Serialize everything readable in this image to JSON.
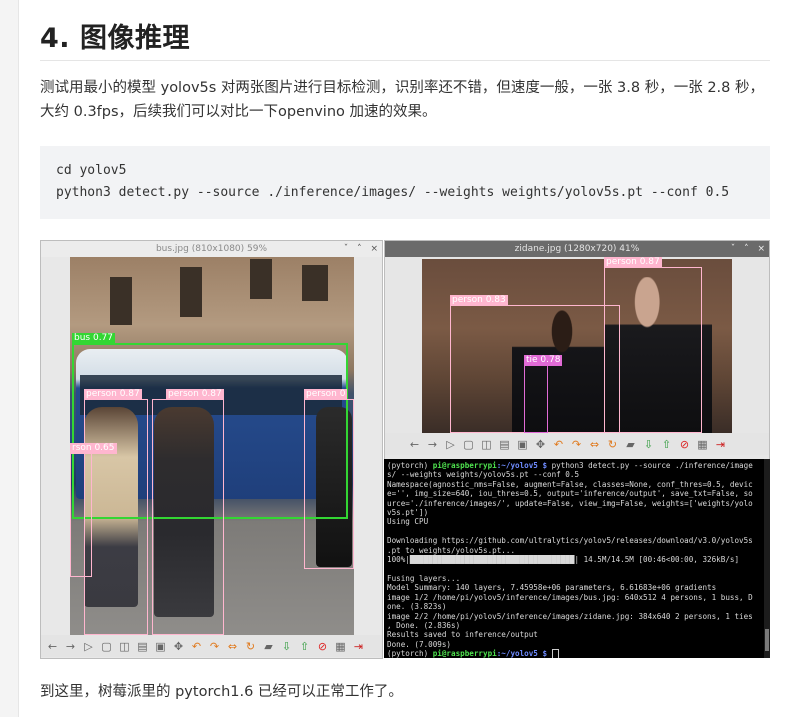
{
  "article": {
    "heading": "4. 图像推理",
    "paragraph": "测试用最小的模型 yolov5s 对两张图片进行目标检测，识别率还不错，但速度一般，一张 3.8 秒，一张 2.8 秒，大约 0.3fps，后续我们可以对比一下openvino 加速的效果。",
    "code_lines": [
      "cd yolov5",
      "python3 detect.py --source ./inference/images/ --weights weights/yolov5s.pt --conf 0.5"
    ],
    "closing": "到这里，树莓派里的 pytorch1.6 已经可以正常工作了。"
  },
  "bus_window": {
    "title": "bus.jpg (810x1080) 59%",
    "controls": [
      "ˇ",
      "˄",
      "×"
    ],
    "labels": {
      "bus": "bus 0.77",
      "person1": "person 0.87",
      "person2": "person 0.87",
      "person3": "person 0",
      "person4": "rson 0.65"
    }
  },
  "zidane_window": {
    "title": "zidane.jpg (1280x720) 41%",
    "controls": [
      "ˇ",
      "˄",
      "×"
    ],
    "labels": {
      "person1": "person 0.83",
      "person2": "person 0.87",
      "tie": "tie 0.78"
    }
  },
  "toolbar_icons": [
    "←",
    "→",
    "▷",
    "▢",
    "◫",
    "▤",
    "▣",
    "✥",
    "↶",
    "↷",
    "⇔",
    "↻",
    "▰",
    "⇩",
    "⇧",
    "⊘",
    "▦",
    "⇥"
  ],
  "terminal": {
    "prompt_env": "(pytorch) ",
    "prompt_user": "pi@raspberrypi",
    "prompt_path": ":~/yolov5 $ ",
    "command": "python3 detect.py --source ./inference/image",
    "lines": [
      "s/ --weights weights/yolov5s.pt --conf 0.5",
      "Namespace(agnostic_nms=False, augment=False, classes=None, conf_thres=0.5, devic",
      "e='', img_size=640, iou_thres=0.5, output='inference/output', save_txt=False, so",
      "urce='./inference/images/', update=False, view_img=False, weights=['weights/yolo",
      "v5s.pt'])",
      "Using CPU",
      "",
      "Downloading https://github.com/ultralytics/yolov5/releases/download/v3.0/yolov5s",
      ".pt to weights/yolov5s.pt...",
      "100%|████████████████████████████████████| 14.5M/14.5M [00:46<00:00, 326kB/s]",
      "",
      "Fusing layers...",
      "Model Summary: 140 layers, 7.45958e+06 parameters, 6.61683e+06 gradients",
      "image 1/2 /home/pi/yolov5/inference/images/bus.jpg: 640x512 4 persons, 1 buss, D",
      "one. (3.823s)",
      "image 2/2 /home/pi/yolov5/inference/images/zidane.jpg: 384x640 2 persons, 1 ties",
      ", Done. (2.836s)",
      "Results saved to inference/output",
      "Done. (7.009s)"
    ],
    "final_env": "(pytorch) ",
    "final_user": "pi@raspberrypi",
    "final_path": ":~/yolov5 $ "
  }
}
